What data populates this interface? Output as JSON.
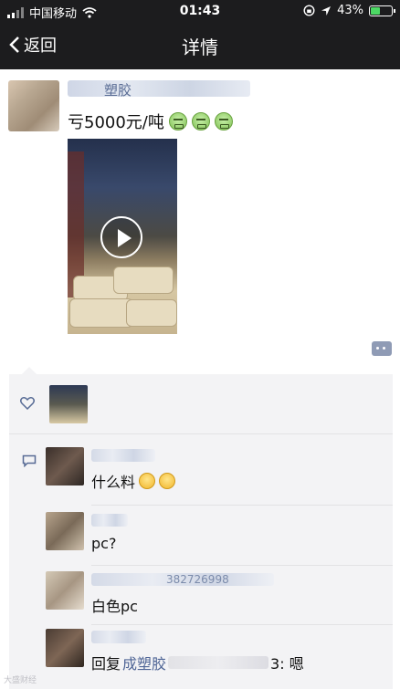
{
  "status_bar": {
    "carrier": "中国移动",
    "time": "01:43",
    "battery": "43%",
    "battery_level": 0.43
  },
  "nav": {
    "back_label": "返回",
    "title": "详情"
  },
  "post": {
    "author": "塑胶",
    "text": "亏5000元/吨",
    "emojis": [
      "angry-green-emoji",
      "angry-green-emoji",
      "angry-green-emoji"
    ],
    "media": "video"
  },
  "comments": [
    {
      "text": "什么料",
      "emojis": [
        "confused-emoji",
        "confused-emoji"
      ]
    },
    {
      "text": "pc?"
    },
    {
      "name_visible": "382726998",
      "text": "白色pc"
    },
    {
      "reply_prefix": "回复",
      "reply_to": "成塑胶",
      "reply_suffix": "3: 嗯"
    }
  ],
  "watermark": "大盛财经",
  "colors": {
    "topbar": "#1c1c1e",
    "link": "#576b95",
    "panel": "#f3f3f5",
    "battery": "#4cd964"
  }
}
